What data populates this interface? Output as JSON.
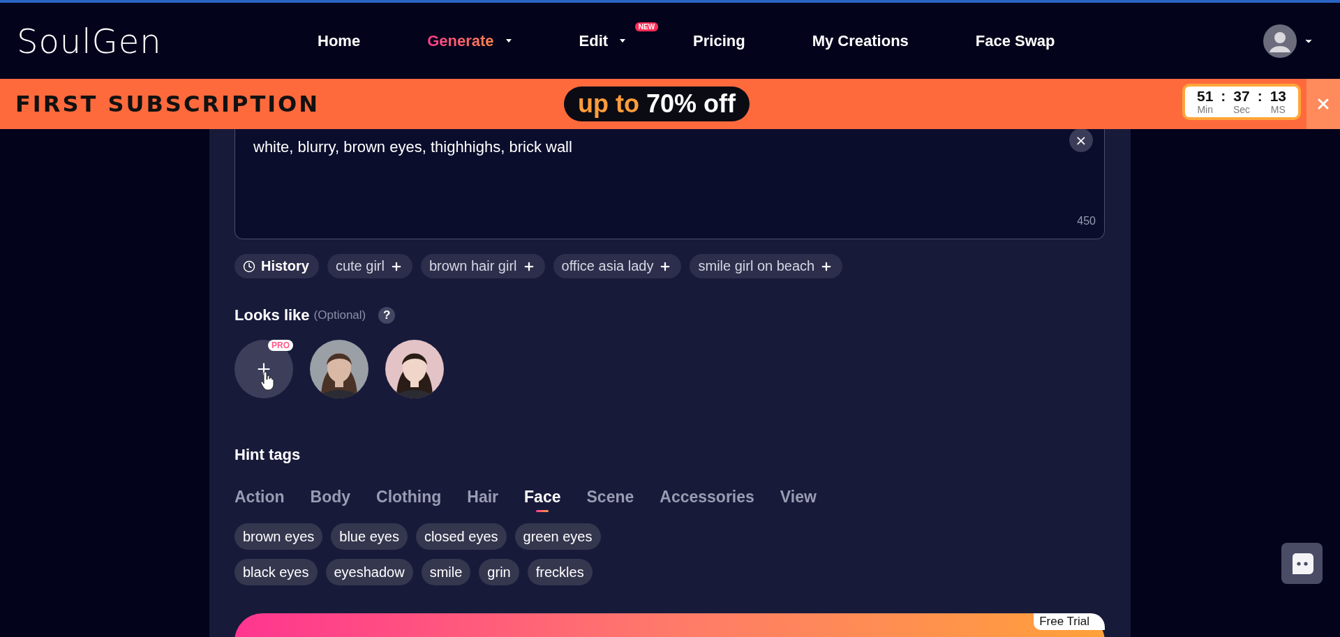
{
  "header": {
    "logo": "SoulGen",
    "nav": [
      {
        "label": "Home",
        "selected": false,
        "dropdown": false
      },
      {
        "label": "Generate",
        "selected": true,
        "dropdown": true
      },
      {
        "label": "Edit",
        "selected": false,
        "dropdown": true,
        "badge": "NEW"
      },
      {
        "label": "Pricing",
        "selected": false,
        "dropdown": false
      },
      {
        "label": "My Creations",
        "selected": false,
        "dropdown": false
      },
      {
        "label": "Face Swap",
        "selected": false,
        "dropdown": false
      }
    ]
  },
  "banner": {
    "title": "FIRST SUBSCRIPTION",
    "promo_accent": "up to",
    "promo_text": "70% off",
    "separator": ":",
    "timer": [
      {
        "value": "51",
        "unit": "Min"
      },
      {
        "value": "37",
        "unit": "Sec"
      },
      {
        "value": "13",
        "unit": "MS"
      }
    ]
  },
  "prompt": {
    "value": "white, blurry, brown eyes, thighhighs, brick wall",
    "clear": "×",
    "count": "450"
  },
  "history": {
    "label": "History"
  },
  "suggestions": [
    "cute girl",
    "brown hair girl",
    "office asia lady",
    "smile girl on beach"
  ],
  "looks_like": {
    "title": "Looks like",
    "note": "(Optional)",
    "help": "?",
    "add_badge": "PRO"
  },
  "hint_tags": {
    "title": "Hint tags",
    "tabs": [
      {
        "label": "Action",
        "selected": false
      },
      {
        "label": "Body",
        "selected": false
      },
      {
        "label": "Clothing",
        "selected": false
      },
      {
        "label": "Hair",
        "selected": false
      },
      {
        "label": "Face",
        "selected": true
      },
      {
        "label": "Scene",
        "selected": false
      },
      {
        "label": "Accessories",
        "selected": false
      },
      {
        "label": "View",
        "selected": false
      }
    ],
    "tags": [
      "brown eyes",
      "blue eyes",
      "closed eyes",
      "green eyes",
      "black eyes",
      "eyeshadow",
      "smile",
      "grin",
      "freckles"
    ]
  },
  "generate": {
    "badge": "Free Trial"
  }
}
